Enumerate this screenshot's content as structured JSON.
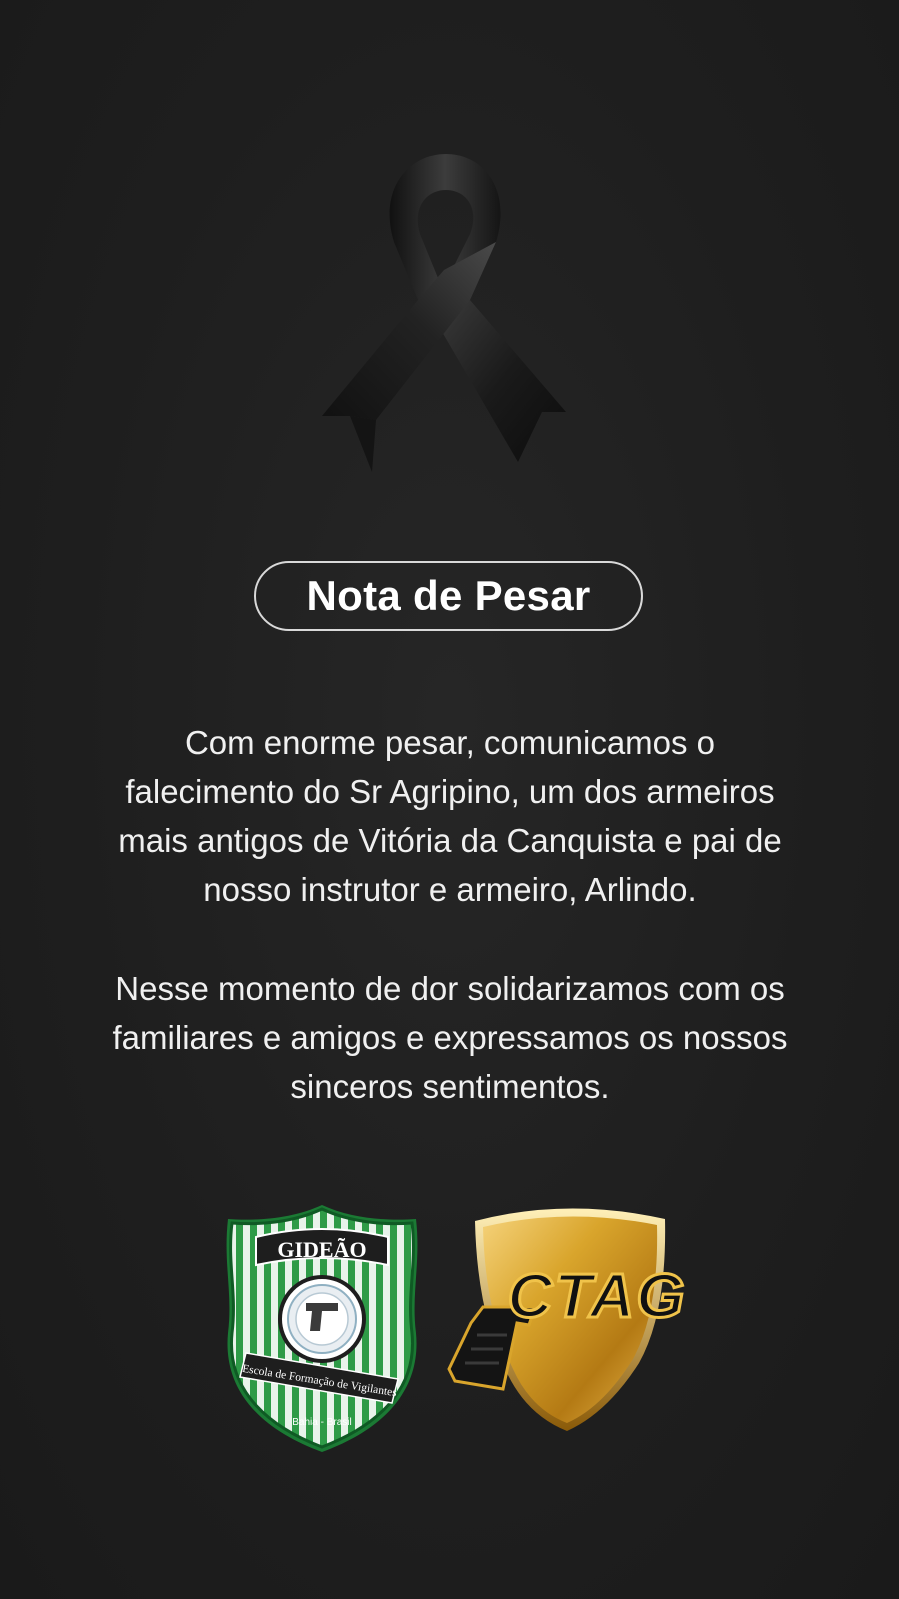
{
  "title": "Nota de Pesar",
  "message": {
    "paragraph_1": "Com enorme pesar, comunicamos o falecimento do Sr Agripino, um dos armeiros mais antigos de Vitória da Canquista e pai de nosso instrutor e armeiro, Arlindo.",
    "paragraph_2": "Nesse momento de dor solidarizamos com os familiares e amigos e expressamos os nossos sinceros sentimentos."
  },
  "logos": {
    "gideao": {
      "name": "GIDEÃO",
      "subtitle": "Escola de Formação de Vigilantes",
      "location": "Bahia - Brasil",
      "icon": "gideao-badge-logo"
    },
    "ctag": {
      "name": "CTAG",
      "icon": "ctag-shield-logo"
    }
  },
  "ribbon": {
    "icon": "black-mourning-ribbon-icon"
  },
  "colors": {
    "background": "#1f1f1f",
    "text": "#f0f0f0",
    "gideao_green": "#1f8a3c",
    "ctag_gold": "#d9a52c"
  }
}
